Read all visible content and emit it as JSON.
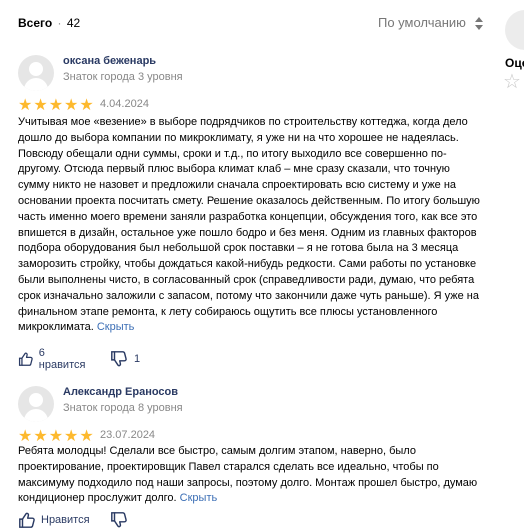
{
  "header": {
    "total_label": "Всего",
    "separator": "·",
    "total_count": "42",
    "sort_label": "По умолчанию"
  },
  "side_panel": {
    "label": "Оце"
  },
  "colors": {
    "star": "#fdb92e",
    "link": "#3b6eb5",
    "author": "#2a3a63",
    "muted": "#888888"
  },
  "reviews": [
    {
      "author": "оксана беженарь",
      "level": "Знаток города 3 уровня",
      "rating": 5,
      "date": "4.04.2024",
      "text": "Учитывая мое «везение» в выборе подрядчиков по строительству коттеджа, когда дело дошло до выбора компании по микроклимату, я уже ни на что хорошее не надеялась. Повсюду обещали одни суммы, сроки и т.д., по итогу выходило все совершенно по-другому. Отсюда первый плюс выбора климат клаб – мне сразу сказали, что точную сумму никто не назовет и предложили сначала спроектировать всю систему и уже на основании проекта посчитать смету. Решение оказалось действенным. По итогу большую часть именно моего времени заняли разработка концепции, обсуждения того, как все это впишется в дизайн, остальное уже пошло бодро и без меня. Одним из главных факторов подбора оборудования был небольшой срок поставки – я не готова была на 3 месяца заморозить стройку, чтобы дождаться какой-нибудь редкости. Сами работы по установке были выполнены чисто, в согласованный срок (справедливости ради, думаю, что ребята срок изначально заложили с запасом, потому что закончили даже чуть раньше). Я уже на финальном этапе ремонта, к лету собираюсь ощутить все плюсы установленного микроклимата.",
      "more_label": "Скрыть",
      "likes_label": "6 нравится",
      "dislikes": "1"
    },
    {
      "author": "Александр Ераносов",
      "level": "Знаток города 8 уровня",
      "rating": 5,
      "date": "23.07.2024",
      "text": "Ребята молодцы! Сделали все быстро, самым долгим этапом, наверно, было проектирование, проектировщик Павел старался сделать все идеально, чтобы по максимуму подходило под наши запросы, поэтому долго. Монтаж прошел быстро, думаю кондиционер прослужит долго.",
      "more_label": "Скрыть",
      "likes_label": "Нравится",
      "dislikes": ""
    }
  ]
}
